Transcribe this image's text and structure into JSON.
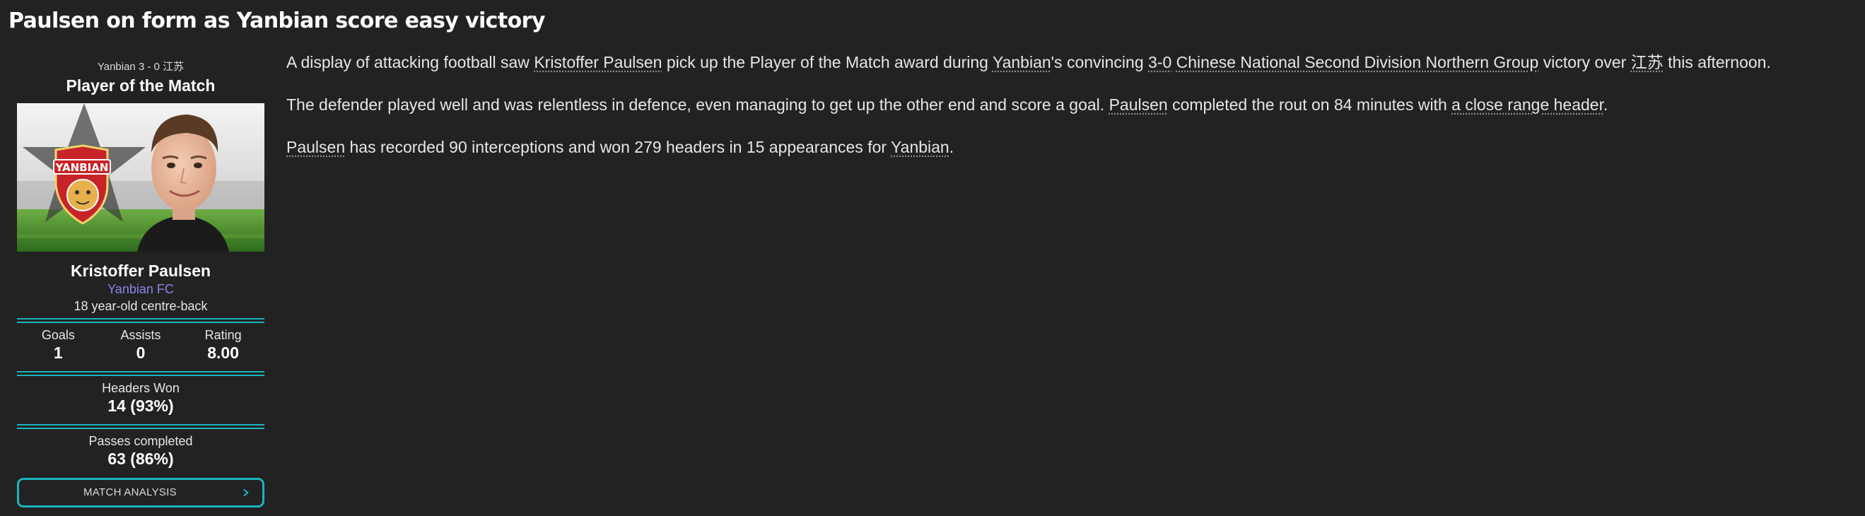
{
  "headline": "Paulsen on form as Yanbian score easy victory",
  "potm": {
    "match_score": "Yanbian 3 - 0 江苏",
    "title": "Player of the Match",
    "club_crest_text": "YANBIAN",
    "player_name": "Kristoffer Paulsen",
    "club": "Yanbian FC",
    "description": "18 year-old centre-back",
    "stats": [
      {
        "label": "Goals",
        "value": "1"
      },
      {
        "label": "Assists",
        "value": "0"
      },
      {
        "label": "Rating",
        "value": "8.00"
      }
    ],
    "headers_won": {
      "label": "Headers Won",
      "value": "14 (93%)"
    },
    "passes_completed": {
      "label": "Passes completed",
      "value": "63 (86%)"
    },
    "match_analysis_label": "MATCH ANALYSIS"
  },
  "article": {
    "p1": {
      "t1": "A display of attacking football saw ",
      "l1": "Kristoffer Paulsen",
      "t2": " pick up the Player of the Match award during ",
      "l2": "Yanbian",
      "t3": "'s convincing ",
      "l3": "3-0",
      "t4": " ",
      "l4": "Chinese National Second Division Northern Group",
      "t5": " victory over ",
      "l5": "江苏",
      "t6": " this afternoon."
    },
    "p2": {
      "t1": "The defender played well and was relentless in defence, even managing to get up the other end and score a goal. ",
      "l1": "Paulsen",
      "t2": " completed the rout on 84 minutes with ",
      "l2": "a close range header",
      "t3": "."
    },
    "p3": {
      "l1": "Paulsen",
      "t1": " has recorded 90 interceptions and won 279 headers in 15 appearances for ",
      "l2": "Yanbian",
      "t2": "."
    }
  },
  "colors": {
    "background": "#222222",
    "accent": "#19b4bd",
    "club_link": "#8a84e8"
  }
}
